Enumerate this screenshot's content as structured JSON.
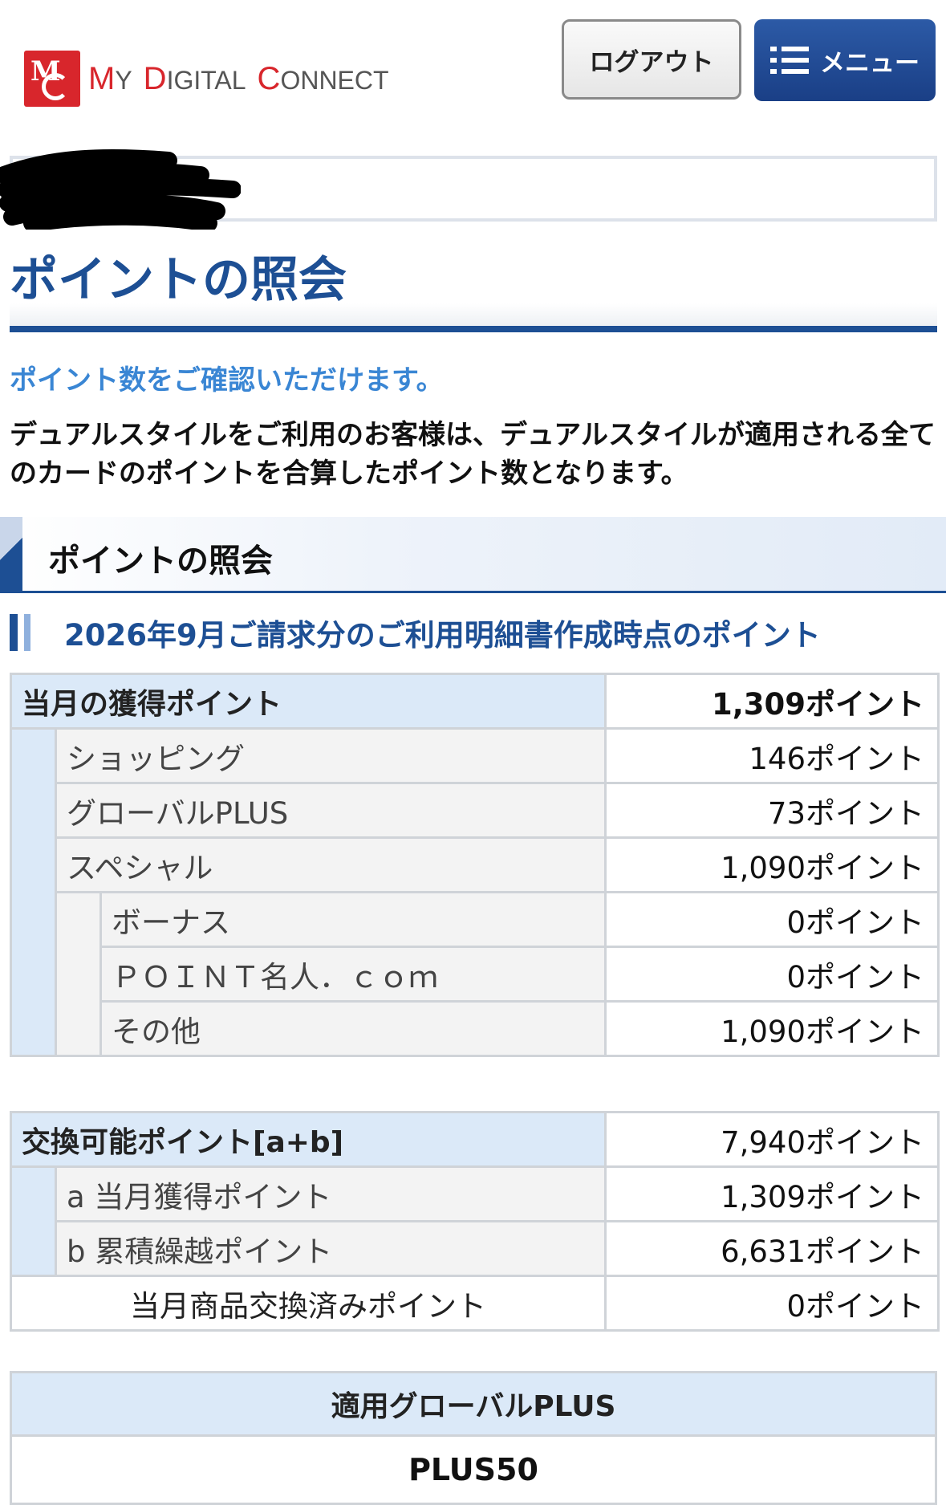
{
  "header": {
    "logo_text": "My Digital Connect",
    "logo_mark": "MDC",
    "logout_label": "ログアウト",
    "menu_label": "メニュー"
  },
  "page": {
    "title": "ポイントの照会",
    "lead": "ポイント数をご確認いただけます。",
    "description": "デュアルスタイルをご利用のお客様は、デュアルスタイルが適用される全てのカードのポイントを合算したポイント数となります。"
  },
  "section": {
    "title": "ポイントの照会",
    "subtitle": "2026年9月ご請求分のご利用明細書作成時点のポイント"
  },
  "monthly": {
    "header_label": "当月の獲得ポイント",
    "header_value": "1,309ポイント",
    "rows": [
      {
        "label": "ショッピング",
        "value": "146ポイント"
      },
      {
        "label": "グローバルPLUS",
        "value": "73ポイント"
      },
      {
        "label": "スペシャル",
        "value": "1,090ポイント"
      }
    ],
    "special_rows": [
      {
        "label": "ボーナス",
        "value": "0ポイント"
      },
      {
        "label": "ＰＯＩＮＴ名人．ｃｏｍ",
        "value": "0ポイント"
      },
      {
        "label": "その他",
        "value": "1,090ポイント"
      }
    ]
  },
  "exchange": {
    "header_label": "交換可能ポイント[a+b]",
    "header_value": "7,940ポイント",
    "rows": [
      {
        "label": "a 当月獲得ポイント",
        "value": "1,309ポイント"
      },
      {
        "label": "b 累積繰越ポイント",
        "value": "6,631ポイント"
      }
    ],
    "redeemed_label": "当月商品交換済みポイント",
    "redeemed_value": "0ポイント"
  },
  "global_plus": {
    "header": "適用グローバルPLUS",
    "value": "PLUS50"
  },
  "colors": {
    "brand_red": "#d8262c",
    "navy": "#1d4f94",
    "accent_blue": "#3a86d4",
    "header_cell": "#dbe9f8"
  }
}
